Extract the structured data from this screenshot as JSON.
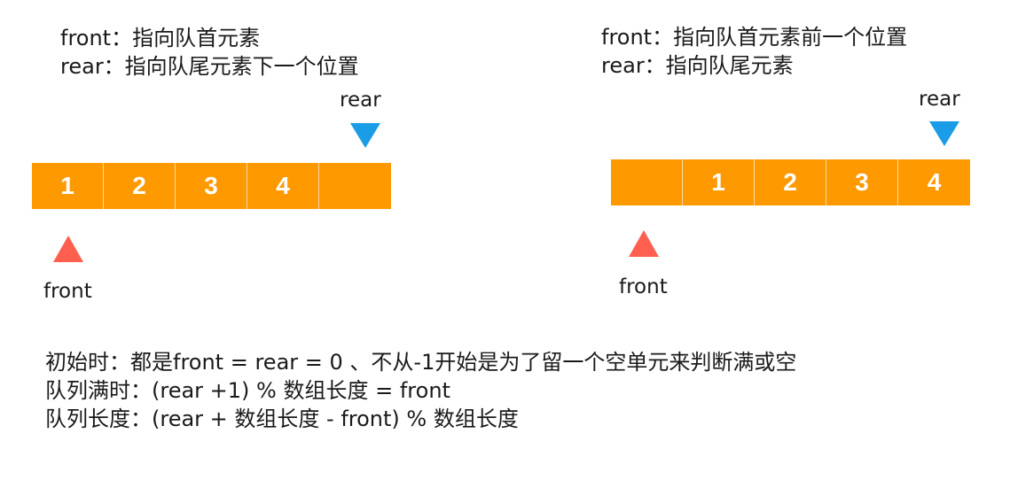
{
  "left": {
    "desc_front": "front：指向队首元素",
    "desc_rear": "rear：指向队尾元素下一个位置",
    "cells": [
      "1",
      "2",
      "3",
      "4",
      ""
    ],
    "rear_label": "rear",
    "front_label": "front"
  },
  "right": {
    "desc_front": "front：指向队首元素前一个位置",
    "desc_rear": "rear：指向队尾元素",
    "cells": [
      "",
      "1",
      "2",
      "3",
      "4"
    ],
    "rear_label": "rear",
    "front_label": "front"
  },
  "notes": {
    "line1": "初始时：都是front = rear = 0 、不从-1开始是为了留一个空单元来判断满或空",
    "line2": "队列满时：(rear +1) % 数组长度 = front",
    "line3": "队列长度：(rear + 数组长度 - front) % 数组长度"
  },
  "colors": {
    "cell": "#ff9900",
    "rear_pointer": "#1b9ce6",
    "front_pointer": "#ff5f4f"
  }
}
